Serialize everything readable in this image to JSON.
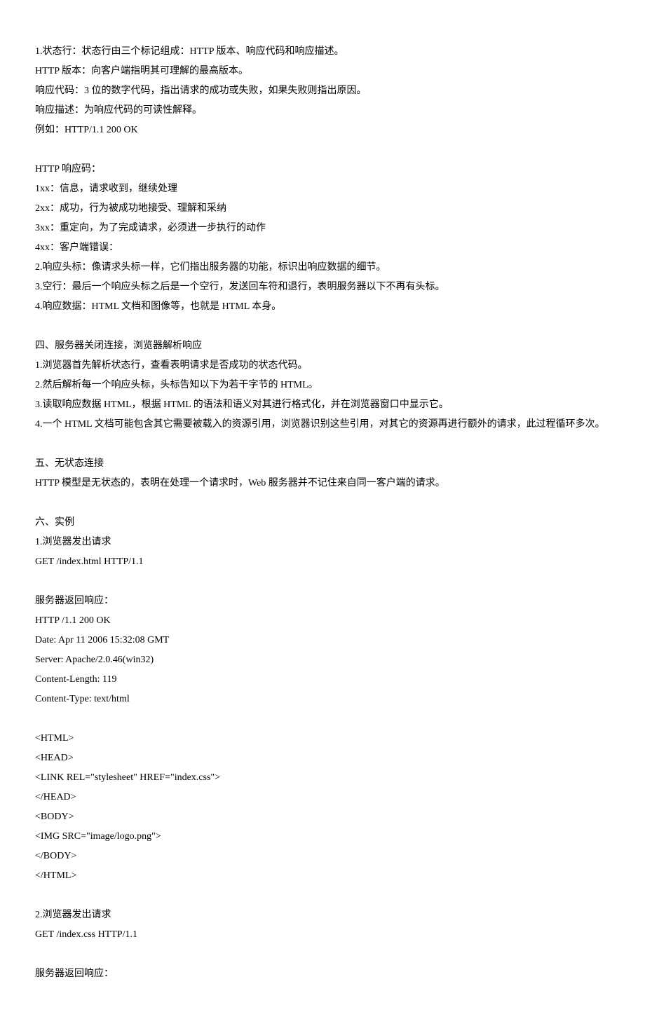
{
  "lines": [
    "1.状态行：状态行由三个标记组成：HTTP 版本、响应代码和响应描述。",
    "HTTP 版本：向客户端指明其可理解的最高版本。",
    "响应代码：3 位的数字代码，指出请求的成功或失败，如果失败则指出原因。",
    "响应描述：为响应代码的可读性解释。",
    "例如：HTTP/1.1 200 OK",
    "",
    "HTTP 响应码：",
    "1xx：信息，请求收到，继续处理",
    "2xx：成功，行为被成功地接受、理解和采纳",
    "3xx：重定向，为了完成请求，必须进一步执行的动作",
    "4xx：客户端错误：",
    "2.响应头标：像请求头标一样，它们指出服务器的功能，标识出响应数据的细节。",
    "3.空行：最后一个响应头标之后是一个空行，发送回车符和退行，表明服务器以下不再有头标。",
    "4.响应数据：HTML 文档和图像等，也就是 HTML 本身。",
    "",
    "四、服务器关闭连接，浏览器解析响应",
    "1.浏览器首先解析状态行，查看表明请求是否成功的状态代码。",
    "2.然后解析每一个响应头标，头标告知以下为若干字节的 HTML。",
    "3.读取响应数据 HTML，根据 HTML 的语法和语义对其进行格式化，并在浏览器窗口中显示它。",
    "4.一个 HTML 文档可能包含其它需要被载入的资源引用，浏览器识别这些引用，对其它的资源再进行额外的请求，此过程循环多次。",
    "",
    "五、无状态连接",
    "HTTP 模型是无状态的，表明在处理一个请求时，Web 服务器并不记住来自同一客户端的请求。",
    "",
    "六、实例",
    "1.浏览器发出请求",
    "GET /index.html HTTP/1.1",
    "",
    "服务器返回响应：",
    "HTTP /1.1 200 OK",
    "Date: Apr 11 2006 15:32:08 GMT",
    "Server: Apache/2.0.46(win32)",
    "Content-Length: 119",
    "Content-Type: text/html",
    "",
    "<HTML>",
    "<HEAD>",
    "<LINK REL=\"stylesheet\" HREF=\"index.css\">",
    "</HEAD>",
    "<BODY>",
    "<IMG SRC=\"image/logo.png\">",
    "</BODY>",
    "</HTML>",
    "",
    "2.浏览器发出请求",
    "GET /index.css HTTP/1.1",
    "",
    "服务器返回响应："
  ]
}
